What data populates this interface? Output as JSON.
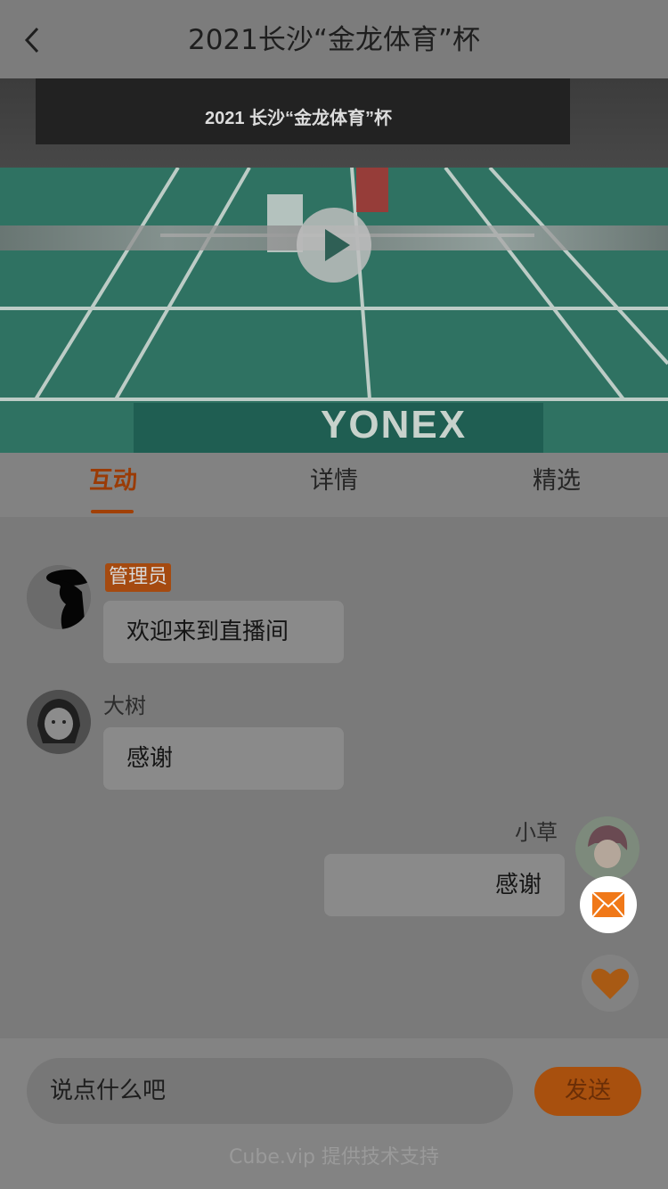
{
  "header": {
    "title": "2021长沙“金龙体育”杯"
  },
  "video": {
    "banner_text": "2021 长沙“金龙体育”杯",
    "court_logo": "YONEX"
  },
  "tabs": [
    {
      "label": "互动"
    },
    {
      "label": "详情"
    },
    {
      "label": "精选"
    }
  ],
  "chat": {
    "messages": [
      {
        "role_badge": "管理员",
        "text": "欢迎来到直播间"
      },
      {
        "name": "大树",
        "text": "感谢"
      },
      {
        "name": "小草",
        "text": "感谢"
      }
    ]
  },
  "footer": {
    "input_placeholder": "说点什么吧",
    "send_label": "发送",
    "powered_by": "Cube.vip 提供技术支持"
  },
  "colors": {
    "accent": "#a14006",
    "overlay_gray": "#7a7a7a"
  }
}
